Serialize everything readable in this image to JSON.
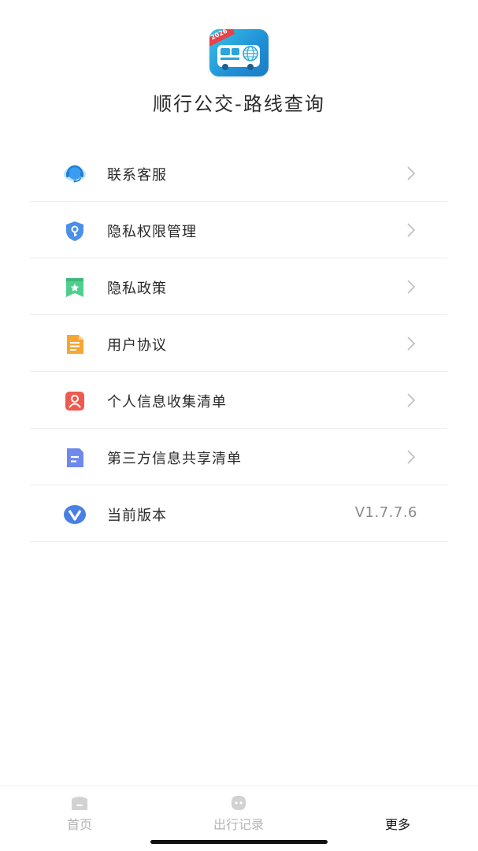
{
  "app": {
    "title": "顺行公交-路线查询",
    "logo_badge": "2026"
  },
  "menu": {
    "items": [
      {
        "label": "联系客服",
        "icon": "customer-service-headset-icon",
        "color": "#3b9df0"
      },
      {
        "label": "隐私权限管理",
        "icon": "shield-key-icon",
        "color": "#4a90e8"
      },
      {
        "label": "隐私政策",
        "icon": "bookmark-star-icon",
        "color": "#4fcf8f"
      },
      {
        "label": "用户协议",
        "icon": "document-icon",
        "color": "#f7a534"
      },
      {
        "label": "个人信息收集清单",
        "icon": "user-card-icon",
        "color": "#ee5a4f"
      },
      {
        "label": "第三方信息共享清单",
        "icon": "file-lines-icon",
        "color": "#6f88ec"
      },
      {
        "label": "当前版本",
        "icon": "version-v-icon",
        "color": "#4a7fe6",
        "value": "V1.7.7.6"
      }
    ]
  },
  "tabs": [
    {
      "label": "首页",
      "icon": "home-bus-icon",
      "active": false
    },
    {
      "label": "出行记录",
      "icon": "travel-record-icon",
      "active": false
    },
    {
      "label": "更多",
      "icon": "",
      "active": true
    }
  ],
  "colors": {
    "inactive_tab": "#b4b4b4",
    "active_tab": "#111111",
    "divider": "#ececec"
  }
}
